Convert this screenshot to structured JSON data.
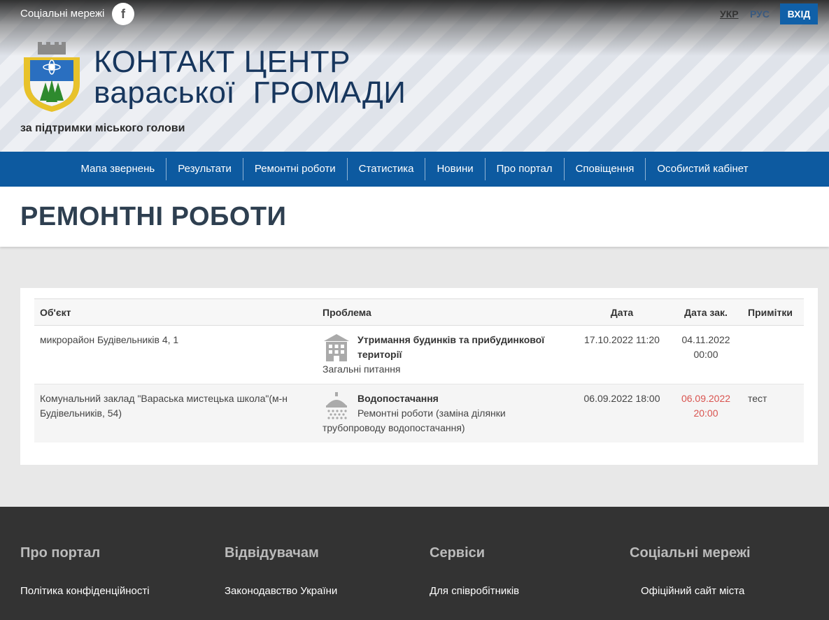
{
  "header": {
    "social_label": "Соціальні мережі",
    "facebook_glyph": "f",
    "lang_ukr": "УКР",
    "lang_rus": "РУС",
    "login_label": "ВХІД",
    "title_line1": "КОНТАКТ ЦЕНТР",
    "title_line2": "вараської  ГРОМАДИ",
    "subtitle": "за підтримки міського голови",
    "colors": {
      "title": "#17365d",
      "login": "#1060a8"
    }
  },
  "nav": {
    "items": [
      {
        "label": "Мапа звернень"
      },
      {
        "label": "Результати"
      },
      {
        "label": "Ремонтні роботи"
      },
      {
        "label": "Статистика"
      },
      {
        "label": "Новини"
      },
      {
        "label": "Про портал"
      },
      {
        "label": "Сповіщення"
      },
      {
        "label": "Особистий кабінет"
      }
    ],
    "color": "#0d5aa0"
  },
  "page": {
    "title": "РЕМОНТНІ РОБОТИ"
  },
  "table": {
    "headers": {
      "object": "Об'єкт",
      "problem": "Проблема",
      "date": "Дата",
      "date_closed": "Дата зак.",
      "notes": "Примітки"
    },
    "rows": [
      {
        "object": "микрорайон Будівельників 4, 1",
        "icon": "building-icon",
        "problem_title": "Утримання будинків та прибудинкової території",
        "problem_desc": "Загальні питання",
        "date": "17.10.2022 11:20",
        "date_closed": "04.11.2022 00:00",
        "notes": ""
      },
      {
        "object": "Комунальний заклад \"Вараська мистецька школа\"(м-н Будівельників, 54)",
        "icon": "shower-icon",
        "problem_title": "Водопостачання",
        "problem_desc": "Ремонтні роботи (заміна ділянки трубопроводу водопостачання)",
        "date": "06.09.2022 18:00",
        "date_closed": "06.09.2022 20:00",
        "notes": "тест"
      }
    ],
    "overdue_color": "#d9534f"
  },
  "footer": {
    "columns": [
      {
        "title": "Про портал",
        "link": "Політика конфіденційності"
      },
      {
        "title": "Відвідувачам",
        "link": "Законодавство України"
      },
      {
        "title": "Сервіси",
        "link": "Для співробітників"
      },
      {
        "title": "Соціальні мережі",
        "link": "Офіційний сайт міста"
      }
    ]
  }
}
